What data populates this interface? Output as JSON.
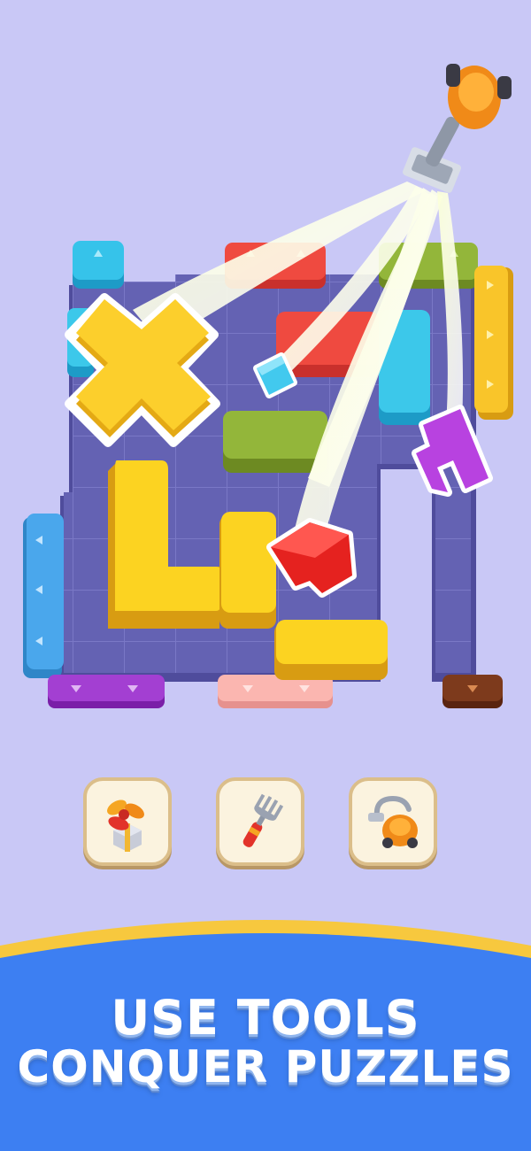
{
  "tools": [
    {
      "icon": "fan-gift-icon"
    },
    {
      "icon": "fork-icon"
    },
    {
      "icon": "vacuum-icon"
    }
  ],
  "headline": {
    "line1": "USE TOOLS",
    "line2": "CONQUER PUZZLES"
  },
  "colors": {
    "background": "#c9c8f6",
    "board": "#5d5aa8",
    "banner": "#3d7ff2",
    "banner_edge": "#f7c83e"
  }
}
